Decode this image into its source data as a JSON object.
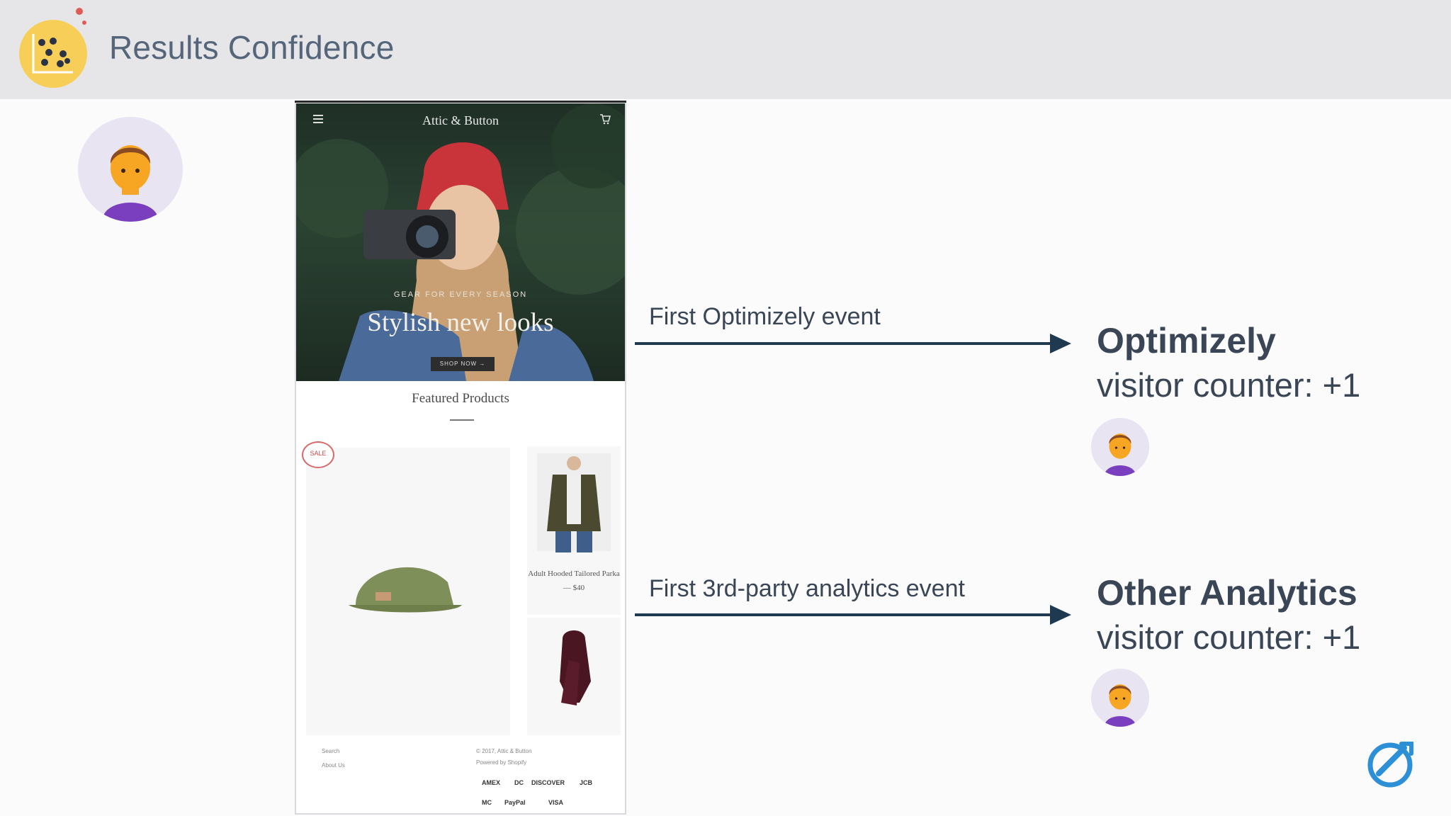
{
  "header": {
    "title": "Results Confidence",
    "logo_icon": "scatter-plot-logo-icon",
    "colors": {
      "bar": "#e6e6e8",
      "logo": "#f7cf58",
      "logo_dots": "#e05a5a"
    }
  },
  "visitor_avatar": {
    "icon": "user-avatar-icon"
  },
  "phone": {
    "menu_icon": "hamburger-menu-icon",
    "brand": "Attic & Button",
    "cart_icon": "cart-icon",
    "hero_tagline": "GEAR FOR EVERY SEASON",
    "hero_heading": "Stylish new looks",
    "hero_button": "SHOP NOW →",
    "featured_title": "Featured Products",
    "sale_badge": "SALE",
    "product_name": "Adult Hooded Tailored Parka\n— $40",
    "footer": {
      "links": [
        "Search",
        "About Us"
      ],
      "copyright": "© 2017, Attic & Button",
      "powered": "Powered by Shopify",
      "payments_row1": [
        "AMEX",
        "DC",
        "DISCOVER",
        "JCB"
      ],
      "payments_row2": [
        "MC",
        "PayPal",
        "VISA"
      ]
    }
  },
  "events": {
    "optimizely_event_label": "First Optimizely event",
    "analytics_event_label": "First 3rd-party analytics event",
    "arrow_color": "#1f3a50"
  },
  "targets": {
    "optimizely": {
      "title": "Optimizely",
      "counter": "visitor counter: +1"
    },
    "analytics": {
      "title": "Other Analytics",
      "counter": "visitor counter: +1"
    }
  },
  "corner_logo": {
    "icon": "optimizely-logo-icon",
    "color": "#2d8fd6"
  }
}
